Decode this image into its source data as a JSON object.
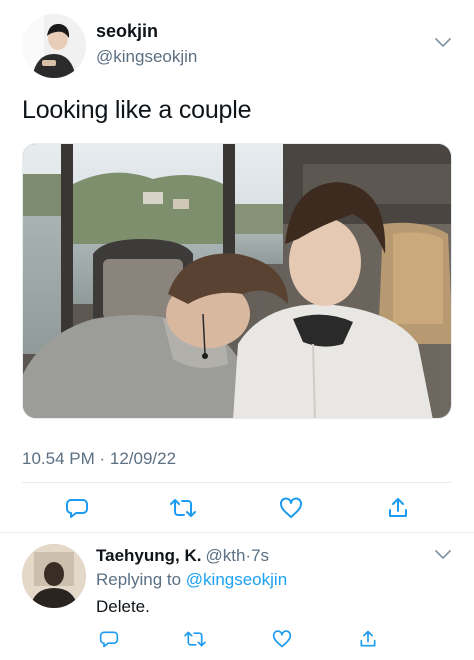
{
  "tweet": {
    "display_name": "seokjin",
    "handle": "@kingseokjin",
    "text": "Looking like a couple",
    "timestamp": "10.54 PM · 12/09/22",
    "actions": [
      "reply-icon",
      "retweet-icon",
      "like-icon",
      "share-icon"
    ]
  },
  "reply": {
    "display_name": "Taehyung, K.",
    "handle": "@kth",
    "time": "·7s",
    "replying_prefix": "Replying to ",
    "replying_to": "@kingseokjin",
    "text": "Delete.",
    "actions": [
      "reply-icon",
      "retweet-icon",
      "like-icon",
      "share-icon"
    ]
  },
  "colors": {
    "text": "#0f1419",
    "secondary": "#5b7083",
    "link": "#1da1f2",
    "divider": "#e6ecf0"
  }
}
